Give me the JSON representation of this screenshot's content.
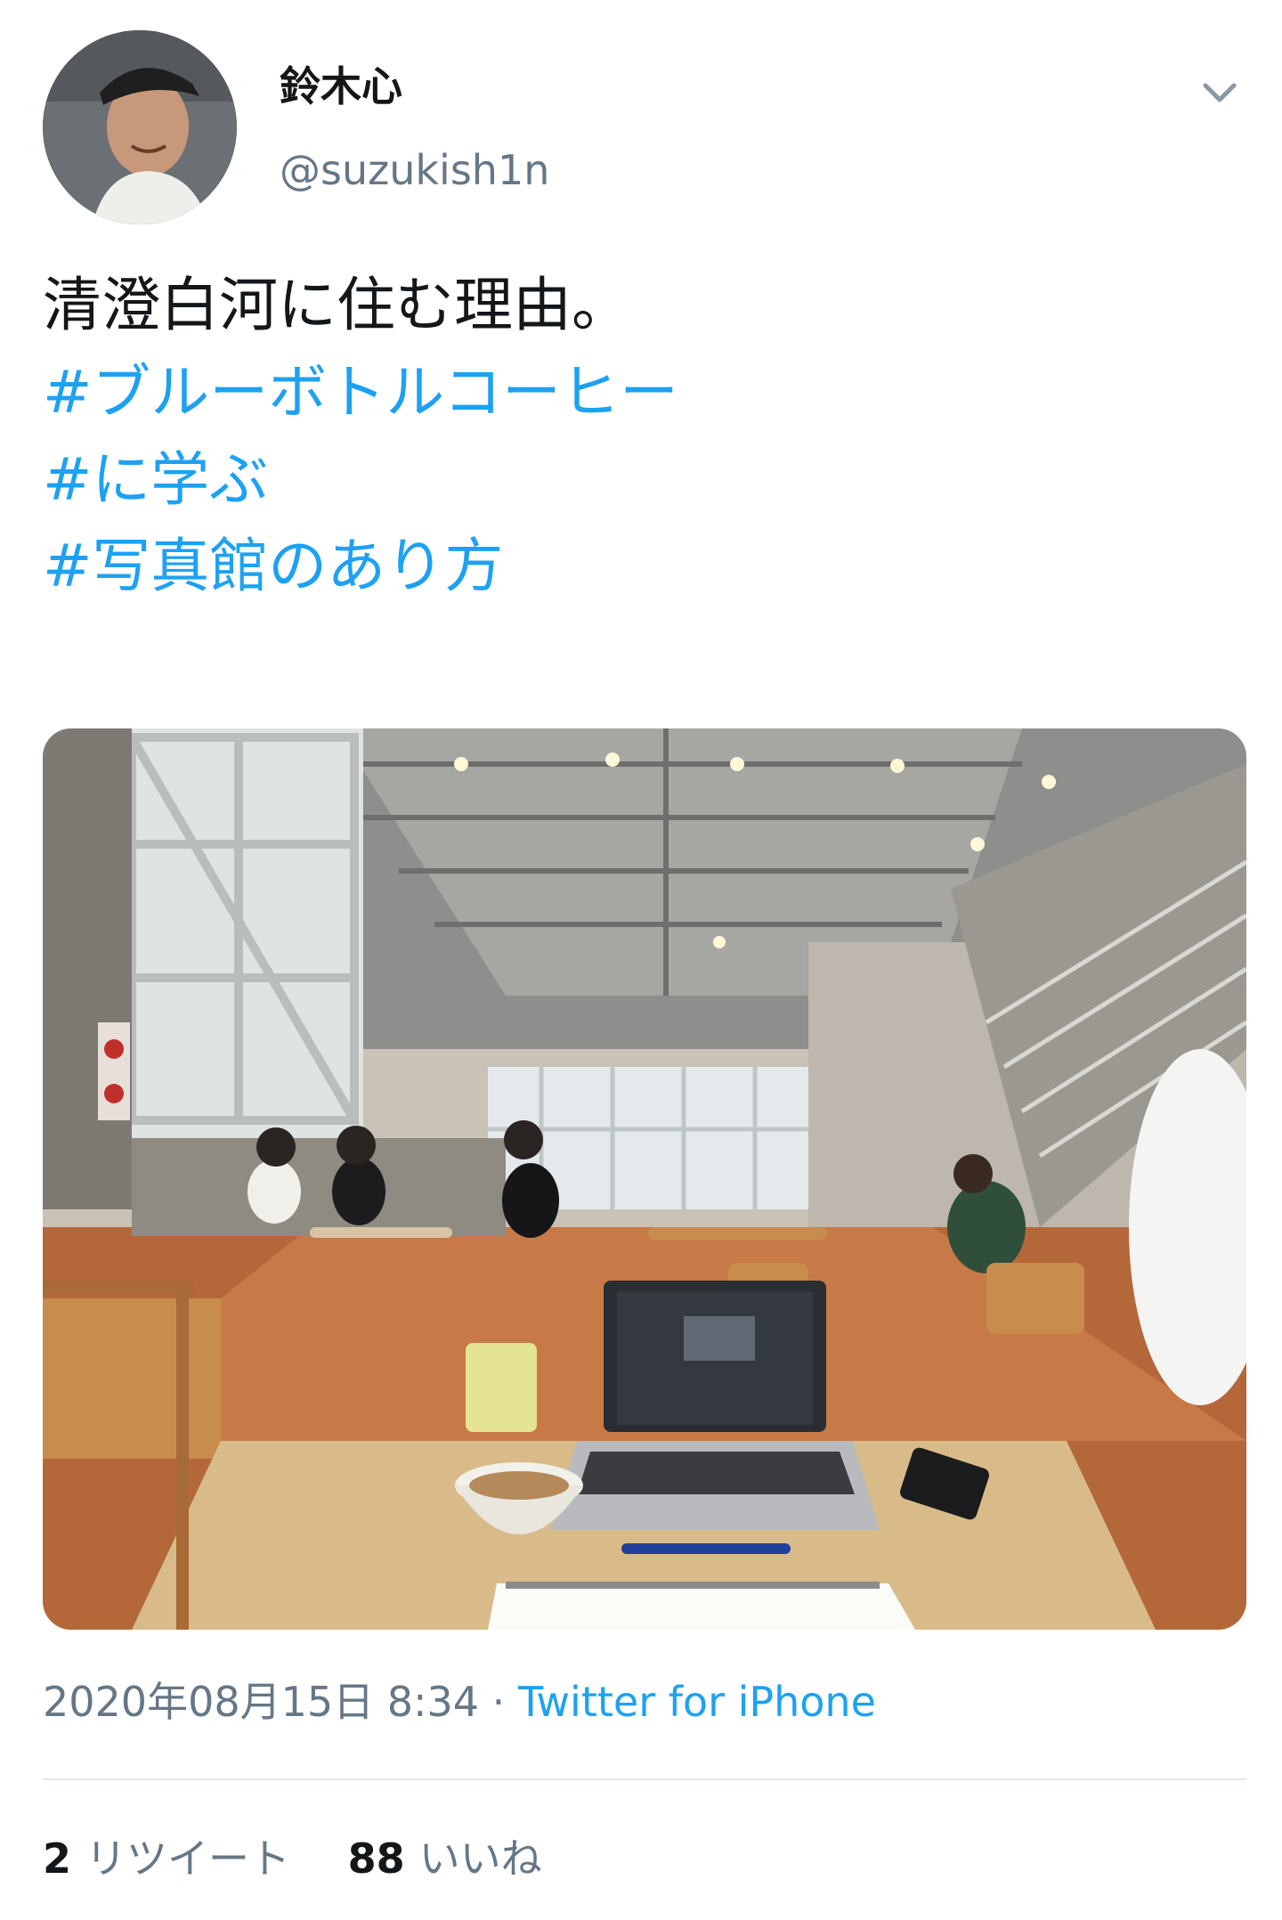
{
  "author": {
    "name": "鈴木心",
    "handle": "@suzukish1n",
    "avatar_icon": "profile-photo"
  },
  "menu_icon": "chevron-down-icon",
  "tweet": {
    "text": "清澄白河に住む理由。",
    "hashtags": [
      "#ブルーボトルコーヒー",
      "#に学ぶ",
      "#写真館のあり方"
    ]
  },
  "photo": {
    "description_icon": "cafe-interior-photo"
  },
  "meta": {
    "timestamp": "2020年08月15日 8:34",
    "separator": " · ",
    "source": "Twitter for iPhone"
  },
  "stats": {
    "retweets_count": "2",
    "retweets_label": "リツイート",
    "likes_count": "88",
    "likes_label": "いいね"
  },
  "colors": {
    "link": "#1da1f2",
    "secondary_text": "#657786",
    "primary_text": "#14171a",
    "divider": "#e1e8ed"
  }
}
